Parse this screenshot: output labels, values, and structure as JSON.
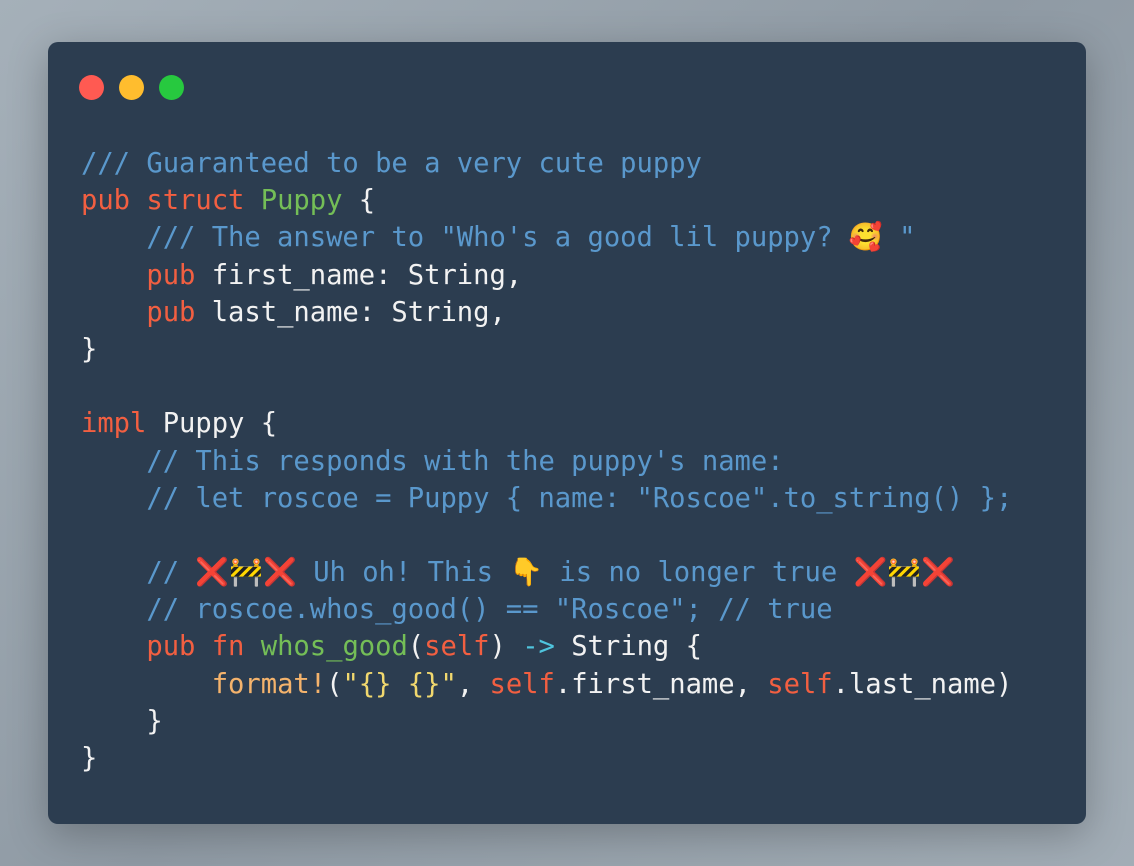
{
  "window": {
    "controls": [
      "close",
      "minimize",
      "maximize"
    ],
    "colors": {
      "background": "#2c3d50",
      "close": "#ff5a52",
      "minimize": "#ffbd2e",
      "maximize": "#27c93f"
    }
  },
  "code": {
    "language": "rust",
    "lines": [
      {
        "tokens": [
          {
            "t": "/// Guaranteed to be a very cute puppy",
            "c": "cm"
          }
        ]
      },
      {
        "tokens": [
          {
            "t": "pub",
            "c": "kw"
          },
          {
            "t": " ",
            "c": "pl"
          },
          {
            "t": "struct",
            "c": "kw"
          },
          {
            "t": " ",
            "c": "pl"
          },
          {
            "t": "Puppy",
            "c": "ty"
          },
          {
            "t": " {",
            "c": "pl"
          }
        ]
      },
      {
        "tokens": [
          {
            "t": "    /// The answer to \"Who's a good lil puppy? ",
            "c": "cm"
          },
          {
            "t": "🥰",
            "c": "emo"
          },
          {
            "t": " \"",
            "c": "cm"
          }
        ]
      },
      {
        "tokens": [
          {
            "t": "    ",
            "c": "pl"
          },
          {
            "t": "pub",
            "c": "kw"
          },
          {
            "t": " first_name: String,",
            "c": "pl"
          }
        ]
      },
      {
        "tokens": [
          {
            "t": "    ",
            "c": "pl"
          },
          {
            "t": "pub",
            "c": "kw"
          },
          {
            "t": " last_name: String,",
            "c": "pl"
          }
        ]
      },
      {
        "tokens": [
          {
            "t": "}",
            "c": "pl"
          }
        ]
      },
      {
        "tokens": [
          {
            "t": "",
            "c": "pl"
          }
        ]
      },
      {
        "tokens": [
          {
            "t": "impl",
            "c": "kw"
          },
          {
            "t": " Puppy {",
            "c": "pl"
          }
        ]
      },
      {
        "tokens": [
          {
            "t": "    // This responds with the puppy's name:",
            "c": "cm"
          }
        ]
      },
      {
        "tokens": [
          {
            "t": "    // let roscoe = Puppy { name: \"Roscoe\".to_string() };",
            "c": "cm"
          }
        ]
      },
      {
        "tokens": [
          {
            "t": "",
            "c": "pl"
          }
        ]
      },
      {
        "tokens": [
          {
            "t": "    // ",
            "c": "cm"
          },
          {
            "t": "❌",
            "c": "emo x"
          },
          {
            "t": "🚧",
            "c": "emo cone"
          },
          {
            "t": "❌",
            "c": "emo x"
          },
          {
            "t": " Uh oh! This ",
            "c": "cm"
          },
          {
            "t": "👇",
            "c": "emo"
          },
          {
            "t": " is no longer true ",
            "c": "cm"
          },
          {
            "t": "❌",
            "c": "emo x"
          },
          {
            "t": "🚧",
            "c": "emo cone"
          },
          {
            "t": "❌",
            "c": "emo x"
          }
        ]
      },
      {
        "tokens": [
          {
            "t": "    // roscoe.whos_good() == \"Roscoe\"; // true",
            "c": "cm"
          }
        ]
      },
      {
        "tokens": [
          {
            "t": "    ",
            "c": "pl"
          },
          {
            "t": "pub",
            "c": "kw"
          },
          {
            "t": " ",
            "c": "pl"
          },
          {
            "t": "fn",
            "c": "kw"
          },
          {
            "t": " ",
            "c": "pl"
          },
          {
            "t": "whos_good",
            "c": "fn"
          },
          {
            "t": "(",
            "c": "pl"
          },
          {
            "t": "self",
            "c": "kw"
          },
          {
            "t": ") ",
            "c": "pl"
          },
          {
            "t": "->",
            "c": "op"
          },
          {
            "t": " String {",
            "c": "pl"
          }
        ]
      },
      {
        "tokens": [
          {
            "t": "        ",
            "c": "pl"
          },
          {
            "t": "format!",
            "c": "mac"
          },
          {
            "t": "(",
            "c": "pl"
          },
          {
            "t": "\"{} {}\"",
            "c": "str"
          },
          {
            "t": ", ",
            "c": "pl"
          },
          {
            "t": "self",
            "c": "kw"
          },
          {
            "t": ".first_name, ",
            "c": "pl"
          },
          {
            "t": "self",
            "c": "kw"
          },
          {
            "t": ".last_name)",
            "c": "pl"
          }
        ]
      },
      {
        "tokens": [
          {
            "t": "    }",
            "c": "pl"
          }
        ]
      },
      {
        "tokens": [
          {
            "t": "}",
            "c": "pl"
          }
        ]
      }
    ]
  }
}
